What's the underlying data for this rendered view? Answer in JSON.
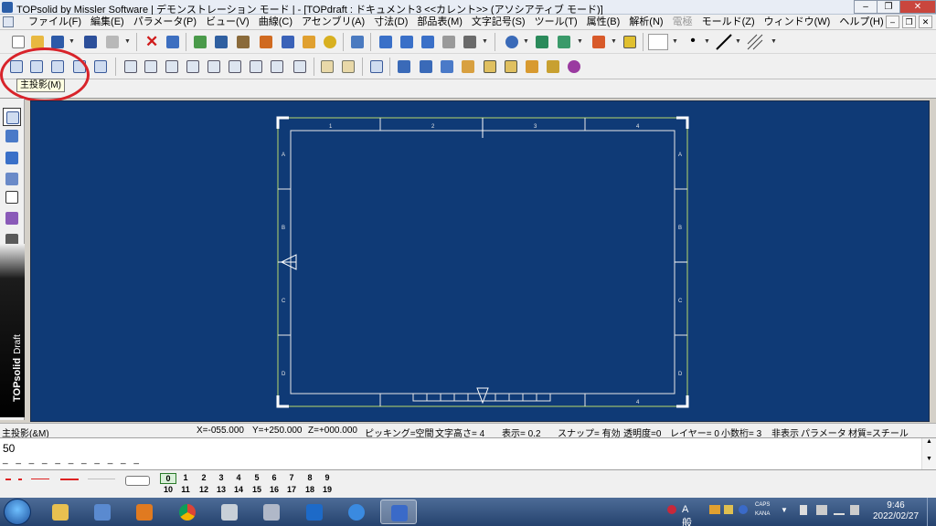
{
  "window": {
    "title": "TOPsolid by Missler Software | デモンストレーション モード | - [TOPdraft : ドキュメント3  <<カレント>> (アソシアティブ モード)]",
    "minimize": "–",
    "maximize": "❐",
    "close": "✕"
  },
  "menu": {
    "items": [
      "ファイル(F)",
      "編集(E)",
      "パラメータ(P)",
      "ビュー(V)",
      "曲線(C)",
      "アセンブリ(A)",
      "寸法(D)",
      "部品表(M)",
      "文字記号(S)",
      "ツール(T)",
      "属性(B)",
      "解析(N)",
      "電極",
      "モールド(Z)",
      "ウィンドウ(W)",
      "ヘルプ(H)"
    ],
    "disabled_item": "電極",
    "mdi_minimize": "–",
    "mdi_restore": "❐",
    "mdi_close": "✕"
  },
  "tooltip": {
    "text": "主投影(M)"
  },
  "brand": {
    "name": "TOPsolid",
    "suffix": "Draft"
  },
  "drawing": {
    "grid_numbers_top": [
      "1",
      "2",
      "3",
      "4"
    ],
    "grid_letters_left": [
      "A",
      "B",
      "C",
      "D"
    ],
    "grid_letters_right": [
      "A",
      "B",
      "C",
      "D"
    ],
    "grid_number_bottom": "4"
  },
  "status": {
    "mode": "主投影(&M)",
    "x": "X=-055.000",
    "y": "Y=+250.000",
    "z": "Z=+000.000",
    "picking": "ピッキング=空間",
    "text_height": "文字高さ=  4",
    "display": "表示=   0.2",
    "snap": "スナップ= 有効",
    "transparency": "透明度=0",
    "layer": "レイヤー=  0",
    "decimals": "小数桁= 3",
    "hidden": "非表示",
    "parameter": "パラメータ",
    "material": "材質=スチール"
  },
  "command": {
    "value": "50",
    "dashes": "_ _ _ _ _ _ _ _ _ _ _"
  },
  "layers": {
    "row1": [
      "0",
      "1",
      "2",
      "3",
      "4",
      "5",
      "6",
      "7",
      "8",
      "9"
    ],
    "row2": [
      "10",
      "11",
      "12",
      "13",
      "14",
      "15",
      "16",
      "17",
      "18",
      "19"
    ],
    "active": "0"
  },
  "taskbar": {
    "time": "9:46",
    "date": "2022/02/27",
    "ime": "A 般",
    "caps": "CAPS",
    "kana": "KANA"
  },
  "colors": {
    "canvas": "#0f3a76",
    "frame": "#e8e8e8",
    "border_line": "#b8d86a",
    "highlight": "#d8232a"
  }
}
